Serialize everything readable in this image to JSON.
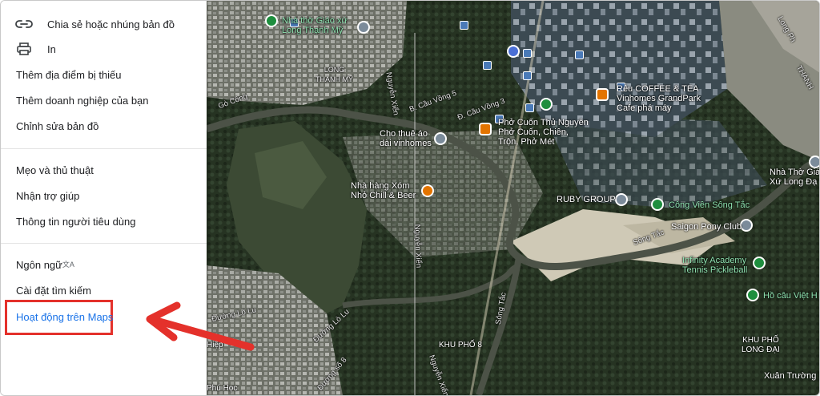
{
  "menu": {
    "items": [
      {
        "label": "Chia sẻ hoặc nhúng bản đồ",
        "icon": "link-icon"
      },
      {
        "label": "In",
        "icon": "printer-icon"
      },
      {
        "label": "Thêm địa điểm bị thiếu"
      },
      {
        "label": "Thêm doanh nghiệp của bạn"
      },
      {
        "label": "Chỉnh sửa bản đồ"
      },
      {
        "label": "Mẹo và thủ thuật"
      },
      {
        "label": "Nhận trợ giúp"
      },
      {
        "label": "Thông tin người tiêu dùng"
      },
      {
        "label": "Ngôn ngữ"
      },
      {
        "label": "Cài đặt tìm kiếm"
      },
      {
        "label": "Hoạt động trên Maps"
      }
    ],
    "language_icon_glyph": "文A",
    "active_color": "#1a73e8",
    "highlight_color": "#e4312b"
  },
  "map": {
    "places": [
      {
        "label": "Nhà thờ Giáo xứ\nLong Thạnh Mỹ"
      },
      {
        "label": "LONG\nTHẠNH MỸ"
      },
      {
        "label": "Rêu COFFEE & TEA\nVinhomes GrandPark\nCafe phá máy"
      },
      {
        "label": "Phở Cuốn Thủ Nguyên\nPhở Cuốn, Chiên,\nTrộn, Phở Mét"
      },
      {
        "label": "Cho thuê áo\ndài vinhomes"
      },
      {
        "label": "Nhà hàng Xóm\nNhỏ Chill & Beer"
      },
      {
        "label": "RUBY GROUP"
      },
      {
        "label": "Công Viên Sông Tắc"
      },
      {
        "label": "Saigon Pony Club"
      },
      {
        "label": "Infinity Academy\nTennis Pickleball"
      },
      {
        "label": "Nhà Thờ Giá\nXứ Long Đạ"
      },
      {
        "label": "Hồ câu Việt H"
      },
      {
        "label": "KHU PHỐ\nLONG ĐẠI"
      },
      {
        "label": "Xuân Trường P"
      },
      {
        "label": "KHU PHỐ 8"
      },
      {
        "label": "Hiệp"
      },
      {
        "label": "Phú Học"
      }
    ],
    "roads": [
      "Gò Công",
      "B. Cầu Vồng 5",
      "Đ. Cầu Vồng 3",
      "Nguyễn Xiển",
      "Nguyễn Xiển",
      "Sông Tắc",
      "Đường Lò Lu",
      "Đường Lò Lu",
      "Đường số 8",
      "Nguyễn Xiển",
      "Sông Tắc",
      "Long Ph",
      "THÀNH"
    ]
  }
}
